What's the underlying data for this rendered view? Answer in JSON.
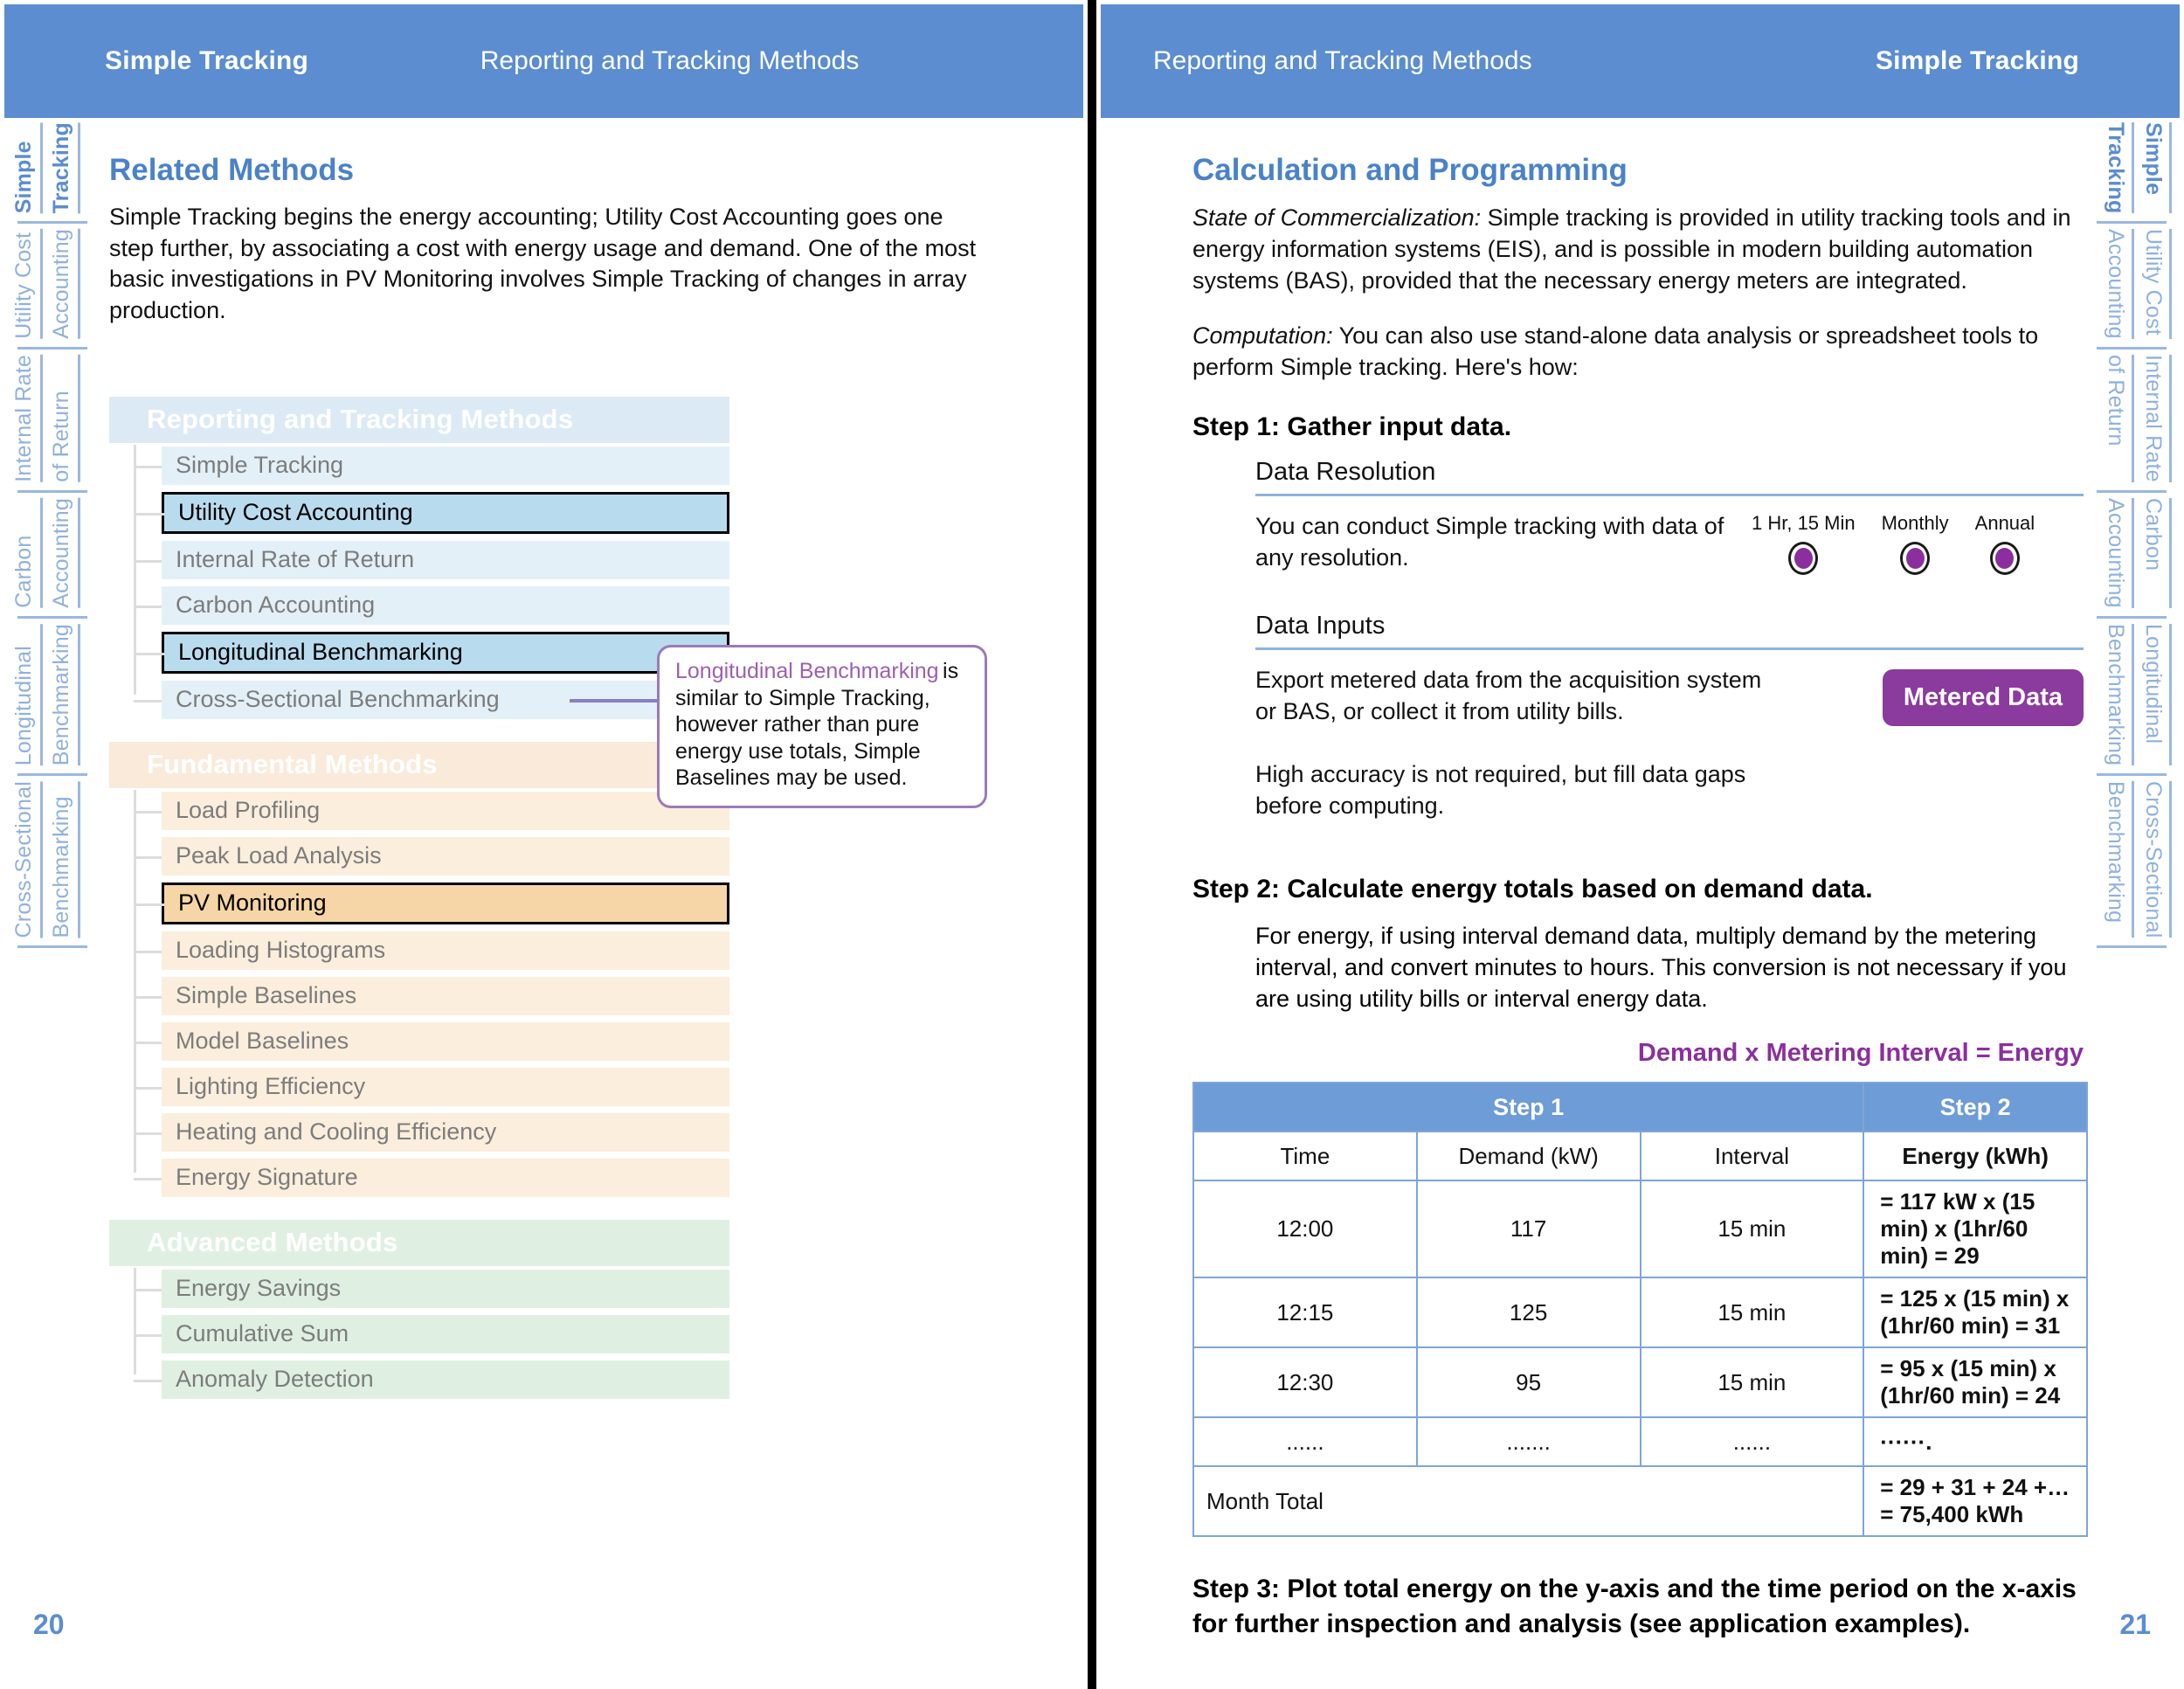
{
  "spread": {
    "left_page": {
      "header": {
        "title": "Simple Tracking",
        "section": "Reporting and Tracking Methods"
      },
      "folio": "20",
      "section_heading": "Related Methods",
      "intro_paragraph": "Simple Tracking begins the energy accounting; Utility Cost Accounting goes one step further, by associating a cost with energy usage and demand. One of the most basic investigations in PV Monitoring involves Simple Tracking of changes in array production.",
      "side_tabs": [
        {
          "line1": "Simple",
          "line2": "Tracking",
          "active": true
        },
        {
          "line1": "Utility Cost",
          "line2": "Accounting",
          "active": false
        },
        {
          "line1": "Internal Rate",
          "line2": "of Return",
          "active": false
        },
        {
          "line1": "Carbon",
          "line2": "Accounting",
          "active": false
        },
        {
          "line1": "Longitudinal",
          "line2": "Benchmarking",
          "active": false
        },
        {
          "line1": "Cross-Sectional",
          "line2": "Benchmarking",
          "active": false
        }
      ],
      "tree": {
        "groups": [
          {
            "title": "Reporting and Tracking Methods",
            "color": "blue",
            "items": [
              {
                "label": "Simple Tracking",
                "highlighted": false
              },
              {
                "label": "Utility Cost Accounting",
                "highlighted": true
              },
              {
                "label": "Internal Rate of Return",
                "highlighted": false
              },
              {
                "label": "Carbon Accounting",
                "highlighted": false
              },
              {
                "label": "Longitudinal Benchmarking",
                "highlighted": true
              },
              {
                "label": "Cross-Sectional Benchmarking",
                "highlighted": false
              }
            ]
          },
          {
            "title": "Fundamental Methods",
            "color": "tan",
            "items": [
              {
                "label": "Load Profiling",
                "highlighted": false
              },
              {
                "label": "Peak Load Analysis",
                "highlighted": false
              },
              {
                "label": "PV Monitoring",
                "highlighted": true
              },
              {
                "label": "Loading Histograms",
                "highlighted": false
              },
              {
                "label": "Simple Baselines",
                "highlighted": false
              },
              {
                "label": "Model Baselines",
                "highlighted": false
              },
              {
                "label": "Lighting Efficiency",
                "highlighted": false
              },
              {
                "label": "Heating and Cooling Efficiency",
                "highlighted": false
              },
              {
                "label": "Energy Signature",
                "highlighted": false
              }
            ]
          },
          {
            "title": "Advanced Methods",
            "color": "green",
            "items": [
              {
                "label": "Energy Savings",
                "highlighted": false
              },
              {
                "label": "Cumulative Sum",
                "highlighted": false
              },
              {
                "label": "Anomaly Detection",
                "highlighted": false
              }
            ]
          }
        ]
      },
      "callout": {
        "title": "Longitudinal Benchmarking",
        "body": "is similar to Simple Tracking, however rather than pure energy use totals, Simple Baselines may be used.",
        "border_color": "#9c7ab8",
        "title_color": "#9d5fb0"
      }
    },
    "right_page": {
      "header": {
        "section": "Reporting and Tracking Methods",
        "title": "Simple Tracking"
      },
      "folio": "21",
      "side_tabs": [
        {
          "line1": "Simple",
          "line2": "Tracking",
          "active": true
        },
        {
          "line1": "Utility Cost",
          "line2": "Accounting",
          "active": false
        },
        {
          "line1": "Internal Rate",
          "line2": "of Return",
          "active": false
        },
        {
          "line1": "Carbon",
          "line2": "Accounting",
          "active": false
        },
        {
          "line1": "Longitudinal",
          "line2": "Benchmarking",
          "active": false
        },
        {
          "line1": "Cross-Sectional",
          "line2": "Benchmarking",
          "active": false
        }
      ],
      "section_heading": "Calculation and Programming",
      "commercialization": {
        "label": "State of Commercialization:",
        "text": " Simple tracking is provided in utility tracking tools and in energy information systems (EIS), and is possible in modern building automation systems (BAS), provided that the necessary energy meters are integrated."
      },
      "computation": {
        "label": "Computation:",
        "text": " You can also use stand-alone data analysis or spreadsheet tools to perform Simple tracking. Here's how:"
      },
      "step1": {
        "heading": "Step 1: Gather input data.",
        "data_resolution": {
          "title": "Data Resolution",
          "text": "You can conduct Simple tracking with data of any resolution.",
          "options": [
            {
              "label": "1 Hr, 15 Min",
              "selected": true
            },
            {
              "label": "Monthly",
              "selected": true
            },
            {
              "label": "Annual",
              "selected": true
            }
          ]
        },
        "data_inputs": {
          "title": "Data Inputs",
          "text1": "Export metered data from the acquisition system or BAS, or collect it from utility bills.",
          "text2": "High accuracy is not required, but fill data gaps before computing.",
          "badge": "Metered Data",
          "badge_color": "#8b3a9e"
        }
      },
      "step2": {
        "heading": "Step 2: Calculate energy totals based on demand data.",
        "text": "For energy, if using interval demand data, multiply demand by the metering interval, and convert minutes to hours. This conversion is not necessary if you are using utility bills or interval energy data.",
        "equation": "Demand x Metering Interval = Energy",
        "accent_color": "#8b2f9e"
      },
      "table": {
        "group_headers": [
          {
            "label": "Step 1",
            "span": 3
          },
          {
            "label": "Step 2",
            "span": 1
          }
        ],
        "columns": [
          "Time",
          "Demand (kW)",
          "Interval",
          "Energy (kWh)"
        ],
        "rows": [
          {
            "time": "12:00",
            "demand": "117",
            "interval": "15 min",
            "energy": "= 117 kW x (15 min) x (1hr/60 min) = 29"
          },
          {
            "time": "12:15",
            "demand": "125",
            "interval": "15 min",
            "energy": "= 125 x (15 min) x (1hr/60 min) = 31"
          },
          {
            "time": "12:30",
            "demand": "95",
            "interval": "15 min",
            "energy": "= 95 x (15 min) x (1hr/60 min) = 24"
          },
          {
            "time": "......",
            "demand": ".......",
            "interval": "......",
            "energy": "······."
          }
        ],
        "total_row": {
          "label": "Month Total",
          "energy": "= 29 + 31 + 24 +… = 75,400 kWh"
        }
      },
      "step3": {
        "heading": "Step 3: Plot total energy on the y-axis and the time period on the x-axis for further inspection and analysis (see application examples)."
      }
    }
  },
  "chart_data": {
    "type": "table",
    "title": "Demand x Metering Interval = Energy",
    "columns": [
      "Time",
      "Demand (kW)",
      "Interval",
      "Energy (kWh)"
    ],
    "rows": [
      [
        "12:00",
        117,
        "15 min",
        29
      ],
      [
        "12:15",
        125,
        "15 min",
        31
      ],
      [
        "12:30",
        95,
        "15 min",
        24
      ]
    ],
    "total": {
      "label": "Month Total",
      "value": 75400,
      "unit": "kWh"
    }
  }
}
